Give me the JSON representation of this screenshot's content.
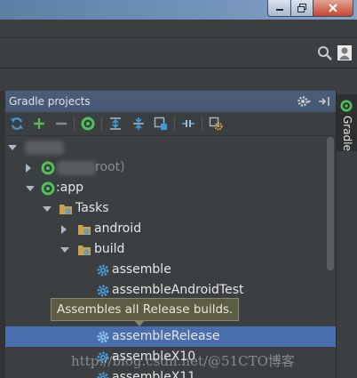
{
  "panel": {
    "title": "Gradle projects"
  },
  "side_tab": {
    "label": "Gradle"
  },
  "tree": {
    "root_suffix": "root)",
    "app": ":app",
    "tasks": "Tasks",
    "android": "android",
    "build": "build",
    "tasks_list": [
      "assemble",
      "assembleAndroidTest",
      "assembleRelease",
      "assembleX10",
      "assembleX11"
    ]
  },
  "tooltip": {
    "text": "Assembles all Release builds."
  },
  "watermark": "http://blog.csdn.net/@51CTO博客",
  "colors": {
    "background": "#3c3f41",
    "selection": "#4b6eaf",
    "gradle_green": "#4fc25a",
    "task_gear_blue": "#4a9ad8"
  },
  "icons": {
    "refresh": "refresh-icon",
    "add": "add-icon",
    "remove": "remove-icon",
    "execute": "gradle-execute-icon",
    "expand_all": "expand-all-icon",
    "collapse_all": "collapse-all-icon",
    "attach": "attach-project-icon",
    "offline": "toggle-offline-icon",
    "settings": "gradle-settings-icon"
  }
}
